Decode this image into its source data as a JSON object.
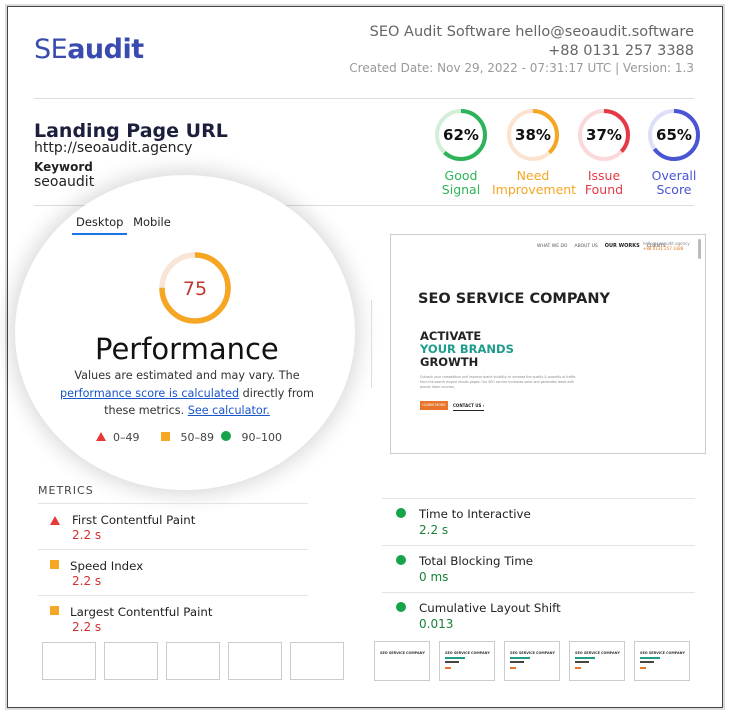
{
  "brand": {
    "logo_prefix": "SE",
    "logo_suffix": "audit"
  },
  "header": {
    "company": "SEO Audit Software",
    "email": "hello@seoaudit.software",
    "phone": "+88 0131 257 3388",
    "meta": "Created Date: Nov 29, 2022 - 07:31:17 UTC | Version: 1.3"
  },
  "landing": {
    "title": "Landing Page URL",
    "url": "http://seoaudit.agency",
    "keyword_label": "Keyword",
    "keyword": "seoaudit"
  },
  "scores": [
    {
      "percent": "62%",
      "value": 62,
      "label_line1": "Good",
      "label_line2": "Signal",
      "color": "#2eb35a",
      "track": "#d3efd9"
    },
    {
      "percent": "38%",
      "value": 38,
      "label_line1": "Need",
      "label_line2": "Improvement",
      "color": "#f5a623",
      "track": "#fbe3cf"
    },
    {
      "percent": "37%",
      "value": 37,
      "label_line1": "Issue",
      "label_line2": "Found",
      "color": "#e53947",
      "track": "#fbd9db"
    },
    {
      "percent": "65%",
      "value": 65,
      "label_line1": "Overall",
      "label_line2": "Score",
      "color": "#4a55d4",
      "track": "#dcdff7"
    }
  ],
  "performance": {
    "tabs": {
      "desktop": "Desktop",
      "mobile": "Mobile"
    },
    "score": "75",
    "score_value": 75,
    "gauge_color": "#f5a623",
    "gauge_track": "#f7e6d8",
    "title": "Performance",
    "desc_part1": "Values are estimated and may vary. The ",
    "desc_link1": "performance score is calculated",
    "desc_part2": " directly from these metrics. ",
    "desc_link2": "See calculator.",
    "legend": {
      "fail": "0–49",
      "average": "50–89",
      "pass": "90–100"
    }
  },
  "preview": {
    "nav": [
      "WHAT WE DO",
      "ABOUT US",
      "OUR WORKS",
      "CLIENTS"
    ],
    "phone_line1": "hello@seoaudit.agency",
    "phone_line2": "+88 0131 257 3388",
    "headline": "SEO SERVICE COMPANY",
    "act_line1": "ACTIVATE",
    "act_line2": "YOUR BRANDS",
    "act_line3": "GROWTH",
    "body": "Outrank your competitive and improve brand visibility to increase the quality & quantity of traffic from the search engine results pages. Our SEO service increases sales and generates leads with proven team success.",
    "btn_primary": "LEARN MORE",
    "btn_secondary": "CONTACT US ›"
  },
  "metrics": {
    "heading": "METRICS",
    "left": [
      {
        "name": "First Contentful Paint",
        "value": "2.2 s",
        "status": "fail"
      },
      {
        "name": "Speed Index",
        "value": "2.2 s",
        "status": "average"
      },
      {
        "name": "Largest Contentful Paint",
        "value": "2.2 s",
        "status": "average"
      }
    ],
    "right": [
      {
        "name": "Time to Interactive",
        "value": "2.2 s",
        "status": "pass"
      },
      {
        "name": "Total Blocking Time",
        "value": "0 ms",
        "status": "pass"
      },
      {
        "name": "Cumulative Layout Shift",
        "value": "0.013",
        "status": "pass"
      }
    ]
  },
  "filmstrip": {
    "first_label": "SEO SERVICE COMPANY",
    "frame_label": "SEO SERVICE COMPANY"
  }
}
